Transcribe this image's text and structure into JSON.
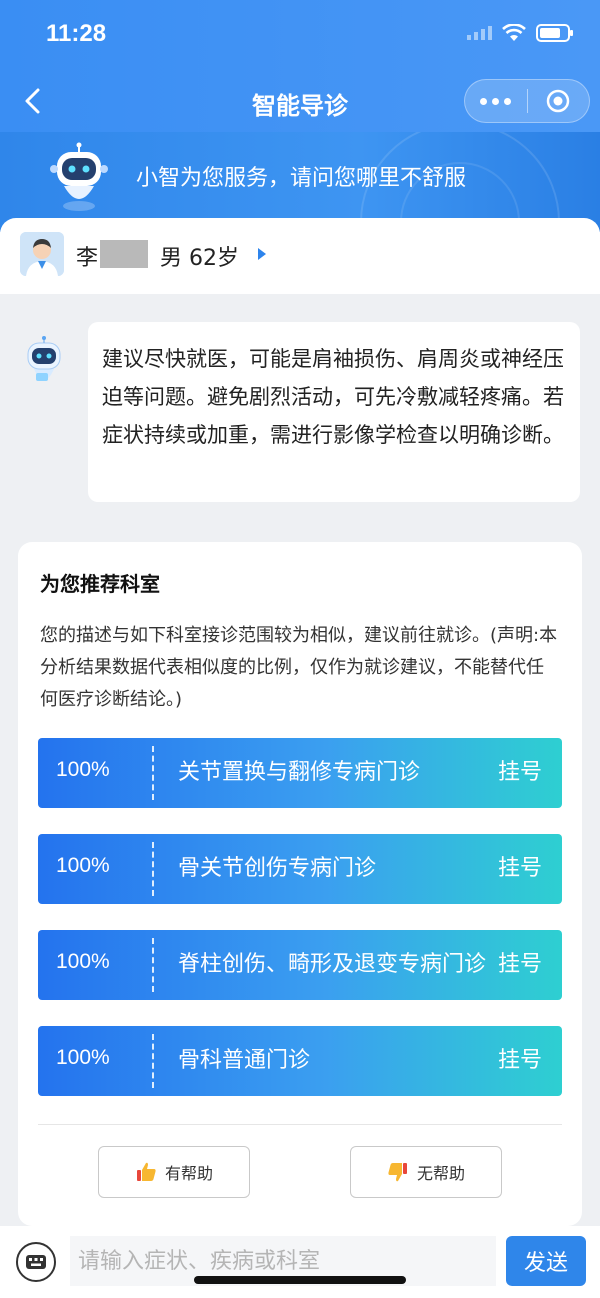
{
  "status_bar": {
    "time": "11:28"
  },
  "nav": {
    "title": "智能导诊"
  },
  "banner": {
    "text": "小智为您服务，请问您哪里不舒服"
  },
  "patient": {
    "surname": "李",
    "info": "男 62岁"
  },
  "chat": {
    "message": "建议尽快就医，可能是肩袖损伤、肩周炎或神经压迫等问题。避免剧烈活动，可先冷敷减轻疼痛。若症状持续或加重，需进行影像学检查以明确诊断。"
  },
  "recommend": {
    "title": "为您推荐科室",
    "description": "您的描述与如下科室接诊范围较为相似，建议前往就诊。(声明:本分析结果数据代表相似度的比例，仅作为就诊建议，不能替代任何医疗诊断结论。)",
    "departments": [
      {
        "percent": "100%",
        "name": "关节置换与翻修专病门诊",
        "action": "挂号"
      },
      {
        "percent": "100%",
        "name": "骨关节创伤专病门诊",
        "action": "挂号"
      },
      {
        "percent": "100%",
        "name": "脊柱创伤、畸形及退变专病门诊",
        "action": "挂号"
      },
      {
        "percent": "100%",
        "name": "骨科普通门诊",
        "action": "挂号"
      }
    ],
    "feedback": {
      "helpful": "有帮助",
      "not_helpful": "无帮助"
    }
  },
  "input": {
    "placeholder": "请输入症状、疾病或科室",
    "send": "发送"
  },
  "colors": {
    "primary": "#2f86ea",
    "gradient_end": "#2ecfd1"
  }
}
